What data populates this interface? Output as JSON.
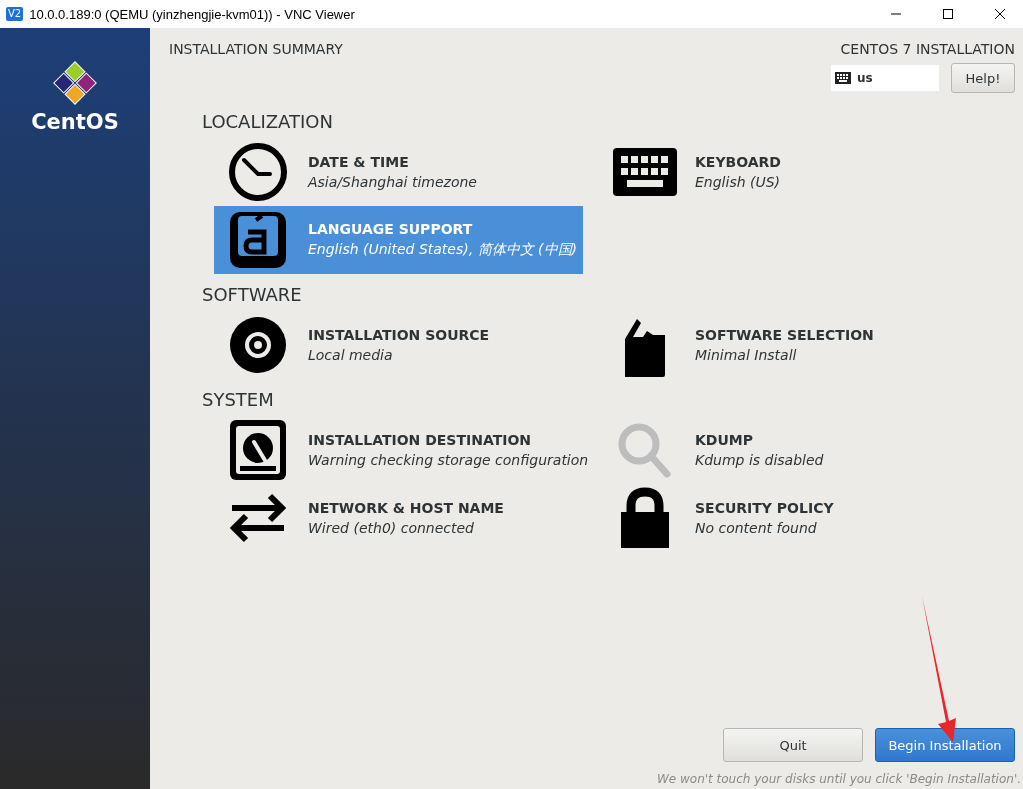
{
  "window": {
    "app_badge": "V2",
    "title": "10.0.0.189:0 (QEMU (yinzhengjie-kvm01)) - VNC Viewer"
  },
  "sidebar": {
    "brand": "CentOS"
  },
  "header": {
    "title": "INSTALLATION SUMMARY",
    "product": "CENTOS 7 INSTALLATION",
    "keyboard_layout": "us",
    "help_button": "Help!"
  },
  "sections": [
    {
      "title": "LOCALIZATION",
      "items": [
        {
          "kind": "clock",
          "title": "DATE & TIME",
          "status": "Asia/Shanghai timezone",
          "selected": false,
          "disabled": false
        },
        {
          "kind": "keyboard",
          "title": "KEYBOARD",
          "status": "English (US)",
          "selected": false,
          "disabled": false
        },
        {
          "kind": "language",
          "title": "LANGUAGE SUPPORT",
          "status": "English (United States), 简体中文 (中国)",
          "selected": true,
          "disabled": false
        }
      ]
    },
    {
      "title": "SOFTWARE",
      "items": [
        {
          "kind": "disc",
          "title": "INSTALLATION SOURCE",
          "status": "Local media",
          "selected": false,
          "disabled": false
        },
        {
          "kind": "package",
          "title": "SOFTWARE SELECTION",
          "status": "Minimal Install",
          "selected": false,
          "disabled": false
        }
      ]
    },
    {
      "title": "SYSTEM",
      "items": [
        {
          "kind": "disk",
          "title": "INSTALLATION DESTINATION",
          "status": "Warning checking storage configuration",
          "selected": false,
          "disabled": false
        },
        {
          "kind": "search",
          "title": "KDUMP",
          "status": "Kdump is disabled",
          "selected": false,
          "disabled": true
        },
        {
          "kind": "network",
          "title": "NETWORK & HOST NAME",
          "status": "Wired (eth0) connected",
          "selected": false,
          "disabled": false
        },
        {
          "kind": "lock",
          "title": "SECURITY POLICY",
          "status": "No content found",
          "selected": false,
          "disabled": false
        }
      ]
    }
  ],
  "footer": {
    "buttons": [
      {
        "label": "Quit",
        "kind": "secondary"
      },
      {
        "label": "Begin Installation",
        "kind": "primary"
      }
    ],
    "note": "We won't touch your disks until you click 'Begin Installation'."
  }
}
